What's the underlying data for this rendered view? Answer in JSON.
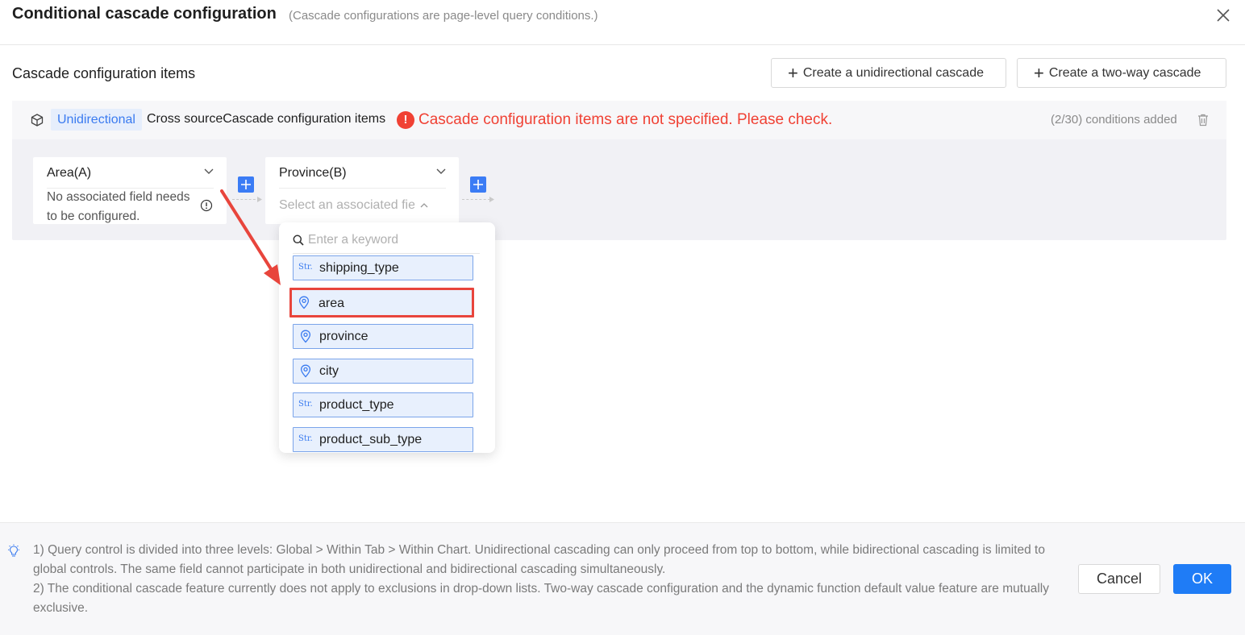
{
  "dialog": {
    "title": "Conditional cascade configuration",
    "subtitle": "(Cascade configurations are page-level query conditions.)",
    "close_icon": "close-icon"
  },
  "section": {
    "title": "Cascade configuration items",
    "create_unidirectional_label": "Create a unidirectional cascade",
    "create_two_way_label": "Create a two-way cascade"
  },
  "cascade_item": {
    "type_tag": "Unidirectional",
    "label": "Cross sourceCascade configuration items",
    "error_message": "Cascade configuration items are not specified. Please check.",
    "error_color": "#f04134",
    "count": "(2/30) conditions added",
    "cards": [
      {
        "label": "Area(A)",
        "note": "No associated field needs to be configured."
      },
      {
        "label": "Province(B)",
        "select_placeholder": "Select an associated fie"
      }
    ]
  },
  "field_dropdown": {
    "search_placeholder": "Enter a keyword",
    "fields": [
      {
        "type": "Str.",
        "icon": "string-icon",
        "name": "shipping_type"
      },
      {
        "type": "geo",
        "icon": "location-pin-icon",
        "name": "area",
        "highlighted": true
      },
      {
        "type": "geo",
        "icon": "location-pin-icon",
        "name": "province"
      },
      {
        "type": "geo",
        "icon": "location-pin-icon",
        "name": "city"
      },
      {
        "type": "Str.",
        "icon": "string-icon",
        "name": "product_type"
      },
      {
        "type": "Str.",
        "icon": "string-icon",
        "name": "product_sub_type"
      }
    ]
  },
  "footer": {
    "note_1": "1) Query control is divided into three levels: Global > Within Tab > Within Chart. Unidirectional cascading can only proceed from top to bottom, while bidirectional cascading is limited to global controls. The same field cannot participate in both unidirectional and bidirectional cascading simultaneously.",
    "note_2": "2) The conditional cascade feature currently does not apply to exclusions in drop-down lists. Two-way cascade configuration and the dynamic function default value feature are mutually exclusive.",
    "cancel_label": "Cancel",
    "ok_label": "OK",
    "accent_color": "#1f7cf6"
  }
}
